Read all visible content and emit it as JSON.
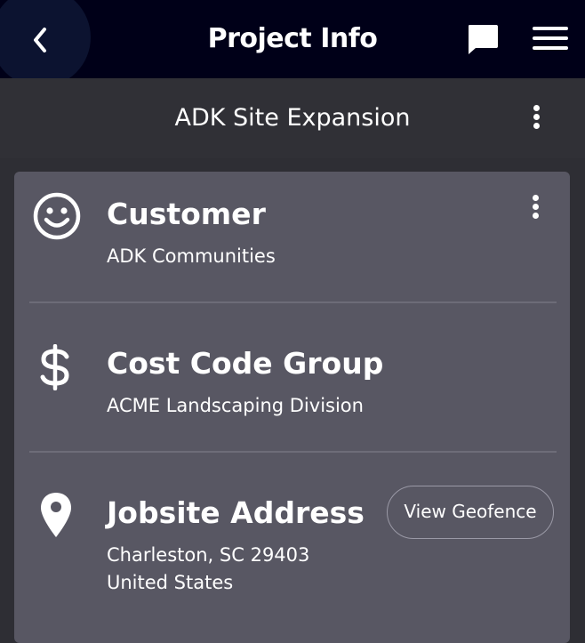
{
  "header": {
    "title": "Project Info",
    "back_icon": "chevron-left-icon",
    "chat_icon": "chat-bubble-icon",
    "menu_icon": "hamburger-menu-icon"
  },
  "project": {
    "name": "ADK Site Expansion",
    "options_icon": "vertical-dots-icon"
  },
  "card": {
    "rows": [
      {
        "title": "Customer",
        "icon": "smiley-face-icon",
        "lines": [
          "ADK Communities"
        ],
        "has_options": true
      },
      {
        "title": "Cost Code Group",
        "icon": "dollar-sign-icon",
        "lines": [
          "ACME Landscaping Division"
        ]
      },
      {
        "title": "Jobsite Address",
        "icon": "map-pin-icon",
        "lines": [
          "Charleston, SC 29403",
          "United States"
        ],
        "action_label": "View Geofence"
      }
    ]
  },
  "colors": {
    "top_bar": "#000018",
    "sub_bar": "#303036",
    "card": "#585763",
    "background": "#2e2e34",
    "text": "#ffffff"
  }
}
